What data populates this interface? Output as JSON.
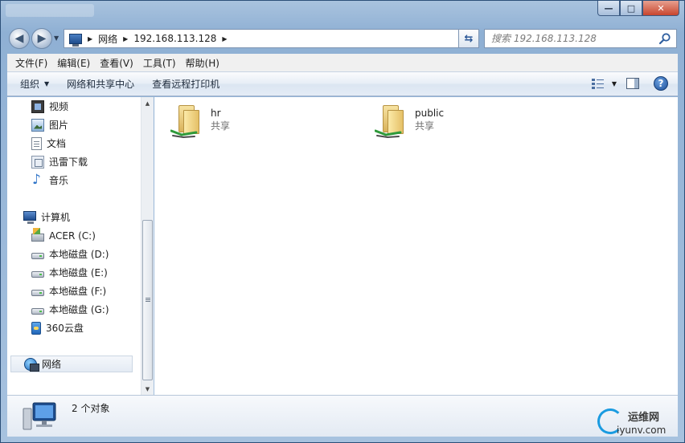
{
  "window": {
    "caption": {
      "minimize": "—",
      "maximize": "□",
      "close": "✕"
    }
  },
  "address": {
    "crumbs": [
      "网络",
      "192.168.113.128"
    ],
    "search_placeholder": "搜索 192.168.113.128"
  },
  "menu": [
    "文件(F)",
    "编辑(E)",
    "查看(V)",
    "工具(T)",
    "帮助(H)"
  ],
  "commands": {
    "organize": "组织",
    "network_center": "网络和共享中心",
    "remote_printers": "查看远程打印机",
    "help": "?"
  },
  "nav_pane": {
    "libraries": [
      "视频",
      "图片",
      "文档",
      "迅雷下载",
      "音乐"
    ],
    "computer": "计算机",
    "drives": [
      "ACER (C:)",
      "本地磁盘 (D:)",
      "本地磁盘 (E:)",
      "本地磁盘 (F:)",
      "本地磁盘 (G:)",
      "360云盘"
    ],
    "network": "网络"
  },
  "shares": [
    {
      "name": "hr",
      "type": "共享"
    },
    {
      "name": "public",
      "type": "共享"
    }
  ],
  "details": {
    "count": "2 个对象"
  },
  "watermark": {
    "top": "运维网",
    "bottom": "iyunv.com"
  },
  "colors": {
    "accent": "#1a9be0",
    "selection": "#e4ebf4"
  }
}
